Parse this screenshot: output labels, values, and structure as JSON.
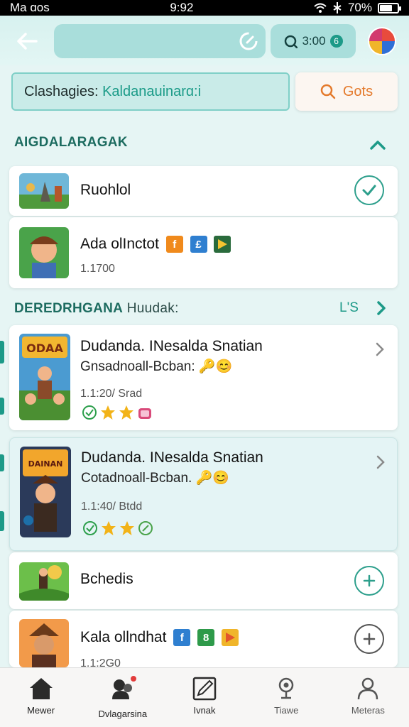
{
  "status_bar": {
    "left_text": "Ma ɑos",
    "time": "9:92",
    "battery": "70%",
    "battery_level": 0.7
  },
  "header": {
    "coins": "3:00",
    "coin_badge": "6"
  },
  "query": {
    "prefix": "Clashagies: ",
    "accent": "Kaldanauinarɑ:i"
  },
  "go_button": {
    "label": "Gots"
  },
  "section1": {
    "title": "AIGDALARAGAK"
  },
  "section2": {
    "title": "DEREDRHGANA",
    "title_suffix": " Huudak:",
    "see_all": "L'S"
  },
  "apps": [
    {
      "name": "Ruohlol"
    },
    {
      "name": "Ada olInctot",
      "badges": [
        "f",
        "£"
      ],
      "meta": "1.1700"
    },
    {
      "name": "Dudanda. INesalda Snatian",
      "subtitle": "Gnsadnoall-Bcban:",
      "meta": "1.1:20/ Srad",
      "poster_text": "ODAA"
    },
    {
      "name": "Dudanda. INesalda Snatian",
      "subtitle": "Cotadnoall-Bcban.",
      "meta": "1.1:40/ Btdd",
      "poster_text": "DAINAN"
    },
    {
      "name": "Bchedis"
    },
    {
      "name": "Kala ollndhat",
      "badges": [
        "f",
        "8"
      ],
      "meta": "1.1:2G0"
    }
  ],
  "nav": [
    {
      "label": "Mewer",
      "icon": "home-icon"
    },
    {
      "label": "Dvlagarsina",
      "icon": "chat-icon"
    },
    {
      "label": "Ivnak",
      "icon": "edit-icon"
    },
    {
      "label": "Tiawe",
      "icon": "location-pin-icon"
    },
    {
      "label": "Meteras",
      "icon": "profile-icon"
    }
  ],
  "colors": {
    "accent": "#1d9a88",
    "orange": "#e47a2c",
    "background": "#e6f5f4"
  }
}
